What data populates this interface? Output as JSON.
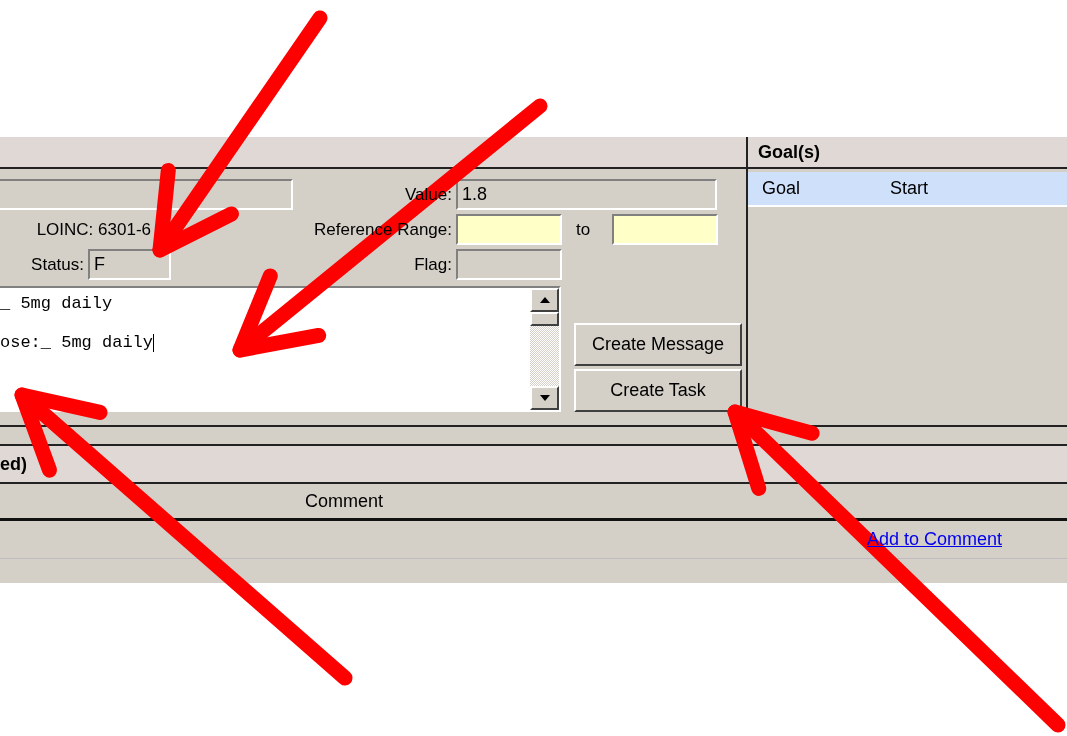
{
  "result_panel": {
    "value_label": "Value:",
    "value": "1.8",
    "loinc": "LOINC: 6301-6",
    "reference_range_label": "Reference Range:",
    "range_to_label": "to",
    "status_label": "Status:",
    "status": "F",
    "flag_label": "Flag:"
  },
  "note": {
    "lines": [
      "_ 5mg daily",
      "ose:_ 5mg daily"
    ]
  },
  "buttons": [
    "Create Message",
    "Create Task"
  ],
  "goals_panel": {
    "title": "Goal(s)",
    "columns": [
      "Goal",
      "Start"
    ]
  },
  "comments_section": {
    "title": "ed)",
    "columns": [
      "Comment"
    ],
    "link": "Add to Comment"
  }
}
